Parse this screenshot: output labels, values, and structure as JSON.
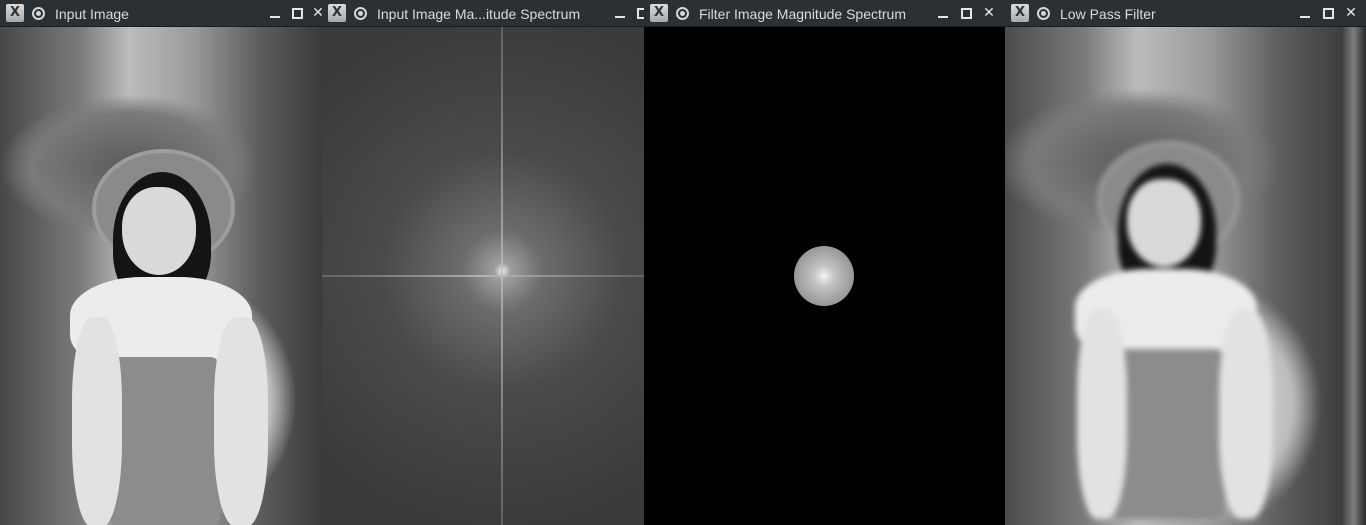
{
  "windows": [
    {
      "title": "Input Image"
    },
    {
      "title": "Input Image Ma...itude Spectrum"
    },
    {
      "title": "Filter Image Magnitude Spectrum"
    },
    {
      "title": "Low Pass Filter"
    }
  ],
  "icons": {
    "app": "x-window-icon",
    "pin": "pin-icon",
    "min": "minimize-icon",
    "max": "maximize-icon",
    "close": "close-icon"
  }
}
